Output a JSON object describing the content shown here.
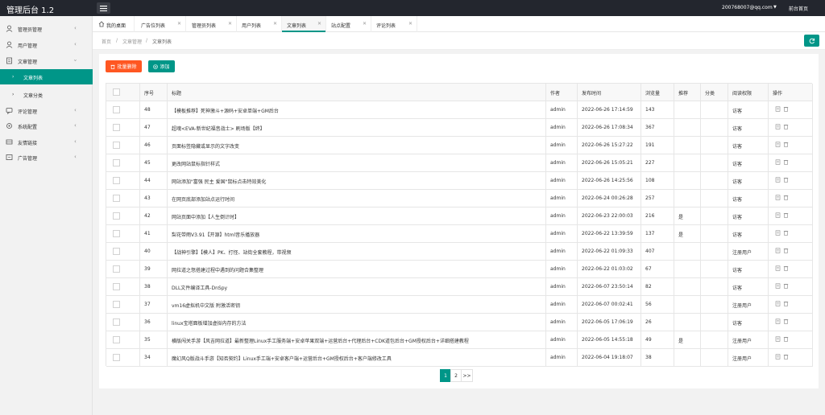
{
  "app": {
    "title": "管理后台 1.2",
    "user_email": "200768007@qq.com",
    "front_link": "前台首页"
  },
  "sidebar": {
    "items": [
      {
        "label": "管理员管理",
        "icon": "user-icon"
      },
      {
        "label": "用户管理",
        "icon": "user-icon"
      },
      {
        "label": "文章管理",
        "icon": "document-icon",
        "expanded": true
      },
      {
        "label": "评论管理",
        "icon": "comment-icon"
      },
      {
        "label": "系统配置",
        "icon": "gear-icon"
      },
      {
        "label": "友情链接",
        "icon": "link-icon"
      },
      {
        "label": "广告管理",
        "icon": "ad-icon"
      }
    ],
    "subitems": [
      {
        "label": "文章列表",
        "active": true
      },
      {
        "label": "文章分类",
        "active": false
      }
    ]
  },
  "tabs": [
    {
      "label": "我的桌面",
      "home": true
    },
    {
      "label": "广告位列表"
    },
    {
      "label": "管理员列表"
    },
    {
      "label": "用户列表"
    },
    {
      "label": "文章列表",
      "active": true
    },
    {
      "label": "站点配置"
    },
    {
      "label": "评论列表"
    }
  ],
  "breadcrumb": [
    "首页",
    "文章管理",
    "文章列表"
  ],
  "breadcrumb_sep": "/",
  "toolbar": {
    "batch_delete": "批量删除",
    "add": "添加"
  },
  "table": {
    "headers": [
      "",
      "序号",
      "标题",
      "作者",
      "发布时间",
      "浏览量",
      "推荐",
      "分类",
      "阅读权限",
      "操作"
    ],
    "rows": [
      {
        "id": "48",
        "title": "【模板推荐】死神激斗+源码+安卓单端+GM后台",
        "author": "admin",
        "time": "2022-06-26 17:14:59",
        "views": "143",
        "rec": "",
        "cat": "",
        "perm": "访客"
      },
      {
        "id": "47",
        "title": "超魂<EVA-新世纪福音战士> 刷场版【终】",
        "author": "admin",
        "time": "2022-06-26 17:08:34",
        "views": "367",
        "rec": "",
        "cat": "",
        "perm": "访客"
      },
      {
        "id": "46",
        "title": "页面标签隐藏或显示的文字改变",
        "author": "admin",
        "time": "2022-06-26 15:27:22",
        "views": "191",
        "rec": "",
        "cat": "",
        "perm": "访客"
      },
      {
        "id": "45",
        "title": "更改网站鼠标指针样式",
        "author": "admin",
        "time": "2022-06-26 15:05:21",
        "views": "227",
        "rec": "",
        "cat": "",
        "perm": "访客"
      },
      {
        "id": "44",
        "title": "网站添加\"富强 民主 爱国\"鼠标点击特效美化",
        "author": "admin",
        "time": "2022-06-26 14:25:56",
        "views": "108",
        "rec": "",
        "cat": "",
        "perm": "访客"
      },
      {
        "id": "43",
        "title": "在网页底部添加站点运行时间",
        "author": "admin",
        "time": "2022-06-24 00:26:28",
        "views": "257",
        "rec": "",
        "cat": "",
        "perm": "访客"
      },
      {
        "id": "42",
        "title": "网站页面中添加【人生倒计时】",
        "author": "admin",
        "time": "2022-06-23 22:00:03",
        "views": "216",
        "rec": "是",
        "cat": "",
        "perm": "访客"
      },
      {
        "id": "41",
        "title": "梨花带雨V3.91【开源】html音乐播放器",
        "author": "admin",
        "time": "2022-06-22 13:39:59",
        "views": "137",
        "rec": "是",
        "cat": "",
        "perm": "访客"
      },
      {
        "id": "40",
        "title": "【战神引擎】【模人】PK、打怪、站街全套教程，带视频",
        "author": "admin",
        "time": "2022-06-22 01:09:33",
        "views": "407",
        "rec": "",
        "cat": "",
        "perm": "注册用户"
      },
      {
        "id": "39",
        "title": "网拉道之怒搭建过程中遇到的问题合集整理",
        "author": "admin",
        "time": "2022-06-22 01:03:02",
        "views": "67",
        "rec": "",
        "cat": "",
        "perm": "访客"
      },
      {
        "id": "38",
        "title": "DLL文件编译工具-DnSpy",
        "author": "admin",
        "time": "2022-06-07 23:50:14",
        "views": "82",
        "rec": "",
        "cat": "",
        "perm": "访客"
      },
      {
        "id": "37",
        "title": "vm16虚拟机中文版 附激活密钥",
        "author": "admin",
        "time": "2022-06-07 00:02:41",
        "views": "56",
        "rec": "",
        "cat": "",
        "perm": "注册用户"
      },
      {
        "id": "36",
        "title": "linux宝塔面板增加虚拟内存的方法",
        "author": "admin",
        "time": "2022-06-05 17:06:19",
        "views": "26",
        "rec": "",
        "cat": "",
        "perm": "访客"
      },
      {
        "id": "35",
        "title": "横版闯关手游【风吉网拉道】最新整理Linux手工服务端+安卓苹果双端+运营后台+代理后台+CDK道包后台+GM授权后台+详细搭建教程",
        "author": "admin",
        "time": "2022-06-05 14:55:18",
        "views": "49",
        "rec": "是",
        "cat": "",
        "perm": "注册用户"
      },
      {
        "id": "34",
        "title": "魔幻风Q版战斗手游【知否契约】Linux手工端+安卓客户端+运营后台+GM授权后台+客户端修改工具",
        "author": "admin",
        "time": "2022-06-04 19:18:07",
        "views": "38",
        "rec": "",
        "cat": "",
        "perm": "注册用户"
      }
    ]
  },
  "pagination": {
    "pages": [
      "1",
      "2"
    ],
    "current": "1",
    "next": ">>"
  }
}
